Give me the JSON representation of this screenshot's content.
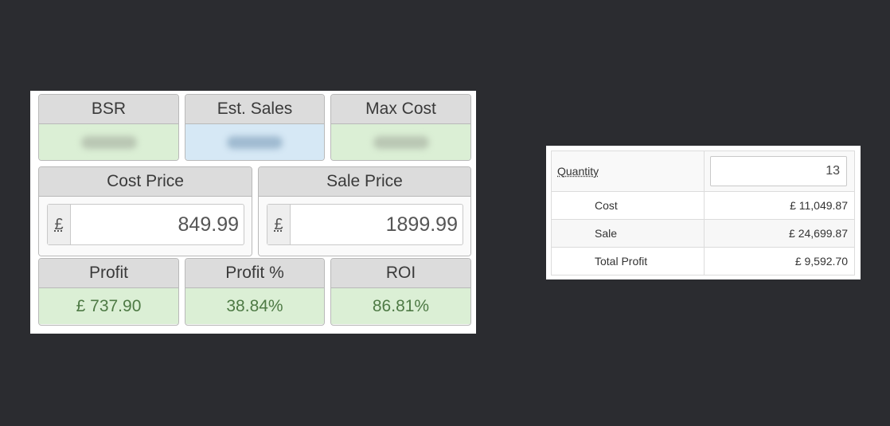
{
  "calculator": {
    "bsr": {
      "label": "BSR"
    },
    "est_sales": {
      "label": "Est. Sales"
    },
    "max_cost": {
      "label": "Max Cost"
    },
    "cost_price": {
      "label": "Cost Price",
      "currency": "£",
      "value": "849.99"
    },
    "sale_price": {
      "label": "Sale Price",
      "currency": "£",
      "value": "1899.99"
    },
    "profit": {
      "label": "Profit",
      "value": "£ 737.90"
    },
    "profit_pct": {
      "label": "Profit %",
      "value": "38.84%"
    },
    "roi": {
      "label": "ROI",
      "value": "86.81%"
    }
  },
  "quantity_table": {
    "quantity_label": "Quantity",
    "quantity_value": "13",
    "rows": [
      {
        "label": "Cost",
        "value": "£ 11,049.87"
      },
      {
        "label": "Sale",
        "value": "£ 24,699.87"
      },
      {
        "label": "Total Profit",
        "value": "£ 9,592.70"
      }
    ]
  },
  "colors": {
    "background": "#2b2c30",
    "positive_fill": "#dbefd5",
    "info_fill": "#d6e8f5",
    "positive_text": "#4e7a45"
  }
}
